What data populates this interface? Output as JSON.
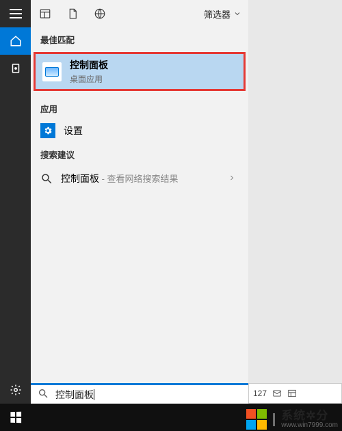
{
  "topbar": {
    "filter_label": "筛选器"
  },
  "results": {
    "best_match_header": "最佳匹配",
    "best_match": {
      "title": "控制面板",
      "subtitle": "桌面应用"
    },
    "apps_header": "应用",
    "apps": [
      {
        "label": "设置"
      }
    ],
    "suggestions_header": "搜索建议",
    "suggestions": [
      {
        "term": "控制面板",
        "hint": " - 查看网络搜索结果"
      }
    ]
  },
  "search": {
    "value": "控制面板"
  },
  "tray": {
    "number": "127"
  },
  "watermark": {
    "line1": "系统✲分",
    "line2": "www.win7999.com"
  }
}
